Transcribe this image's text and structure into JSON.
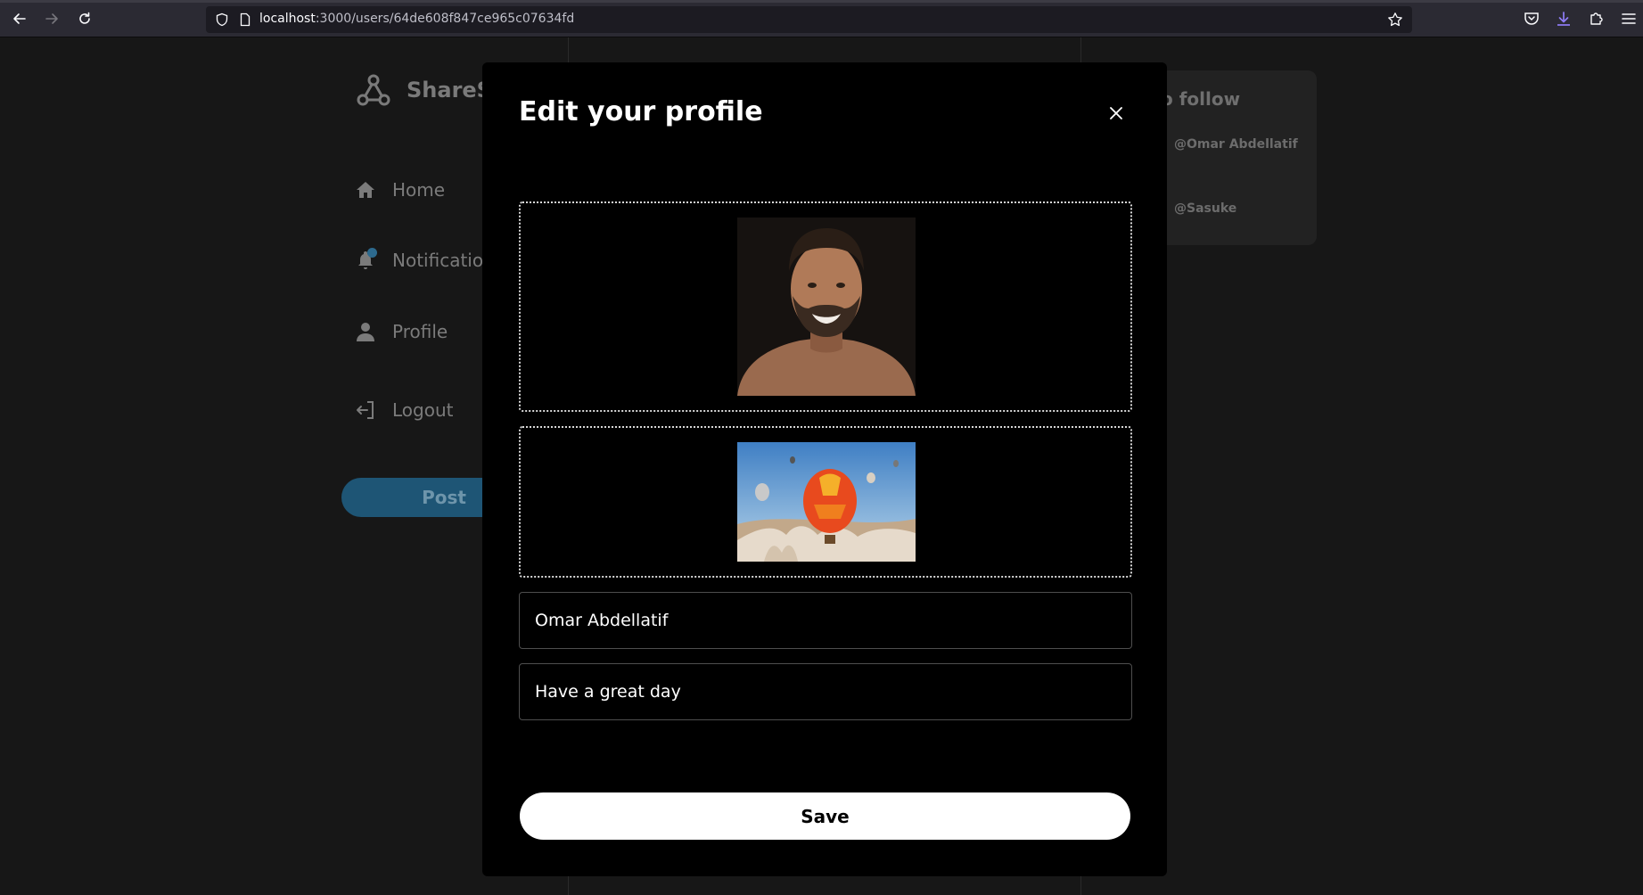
{
  "browser": {
    "url_host": "localhost",
    "url_path": ":3000/users/64de608f847ce965c07634fd"
  },
  "app": {
    "brand": "ShareSp",
    "sidebar": {
      "items": [
        {
          "label": "Home",
          "icon": "home-icon"
        },
        {
          "label": "Notifications",
          "icon": "bell-icon"
        },
        {
          "label": "Profile",
          "icon": "user-icon"
        },
        {
          "label": "Logout",
          "icon": "logout-icon"
        }
      ],
      "post_label": "Post"
    },
    "follow_panel": {
      "title": "o follow",
      "handles": [
        "@Omar Abdellatif",
        "@Sasuke"
      ]
    }
  },
  "modal": {
    "title": "Edit your profile",
    "name_value": "Omar Abdellatif",
    "bio_value": "Have a great day",
    "save_label": "Save"
  },
  "colors": {
    "page_bg": "#171717",
    "modal_bg": "#000000",
    "accent": "#1e5575",
    "save_bg": "#ffffff"
  }
}
